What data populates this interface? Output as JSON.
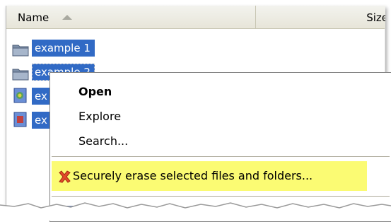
{
  "columns": {
    "name": "Name",
    "size": "Size"
  },
  "files": [
    {
      "name": "example 1",
      "icon": "folder-icon"
    },
    {
      "name": "example 2",
      "icon": "folder-icon"
    },
    {
      "name": "ex",
      "icon": "document-icon"
    },
    {
      "name": "ex",
      "icon": "document-icon"
    }
  ],
  "context_menu": {
    "open": "Open",
    "explore": "Explore",
    "search": "Search...",
    "secure_erase": "Securely erase selected files and folders...",
    "secure_erase_icon": "red-x-icon"
  },
  "colors": {
    "selection": "#316ac5",
    "highlight": "#fbfb73"
  }
}
